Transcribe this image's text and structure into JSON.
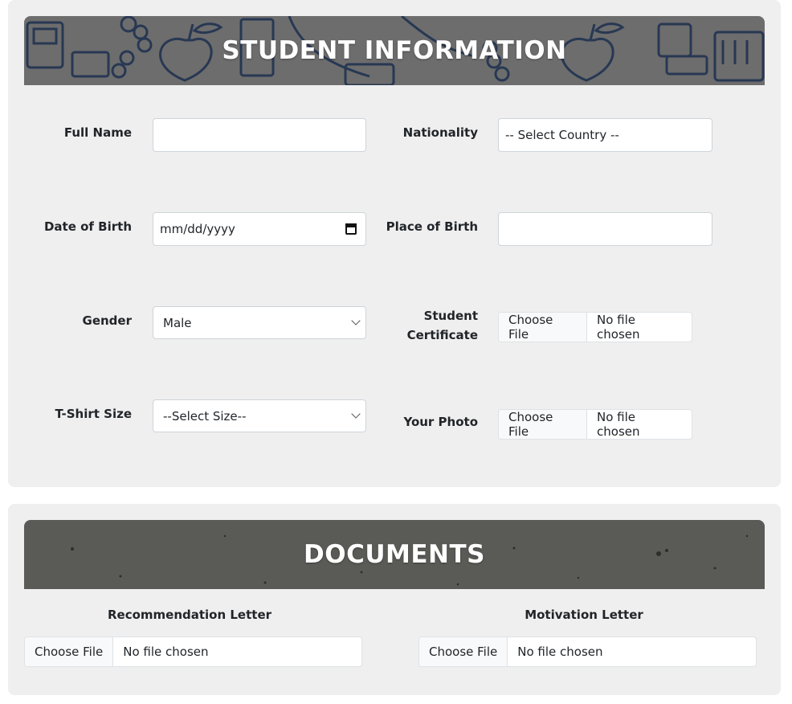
{
  "student": {
    "title": "STUDENT INFORMATION",
    "full_name_label": "Full Name",
    "full_name_value": "",
    "nationality_label": "Nationality",
    "nationality_value": "-- Select Country --",
    "dob_label": "Date of Birth",
    "dob_placeholder": "mm/dd/yyyy",
    "pob_label": "Place of Birth",
    "pob_value": "",
    "gender_label": "Gender",
    "gender_value": "Male",
    "certificate_label_line1": "Student",
    "certificate_label_line2": "Certificate",
    "tshirt_label": "T-Shirt Size",
    "tshirt_value": "--Select Size--",
    "photo_label": "Your Photo"
  },
  "file_input": {
    "button": "Choose File",
    "status": "No file chosen"
  },
  "documents": {
    "title": "DOCUMENTS",
    "recommendation_label": "Recommendation Letter",
    "motivation_label": "Motivation Letter"
  },
  "colors": {
    "card_bg": "#efefef",
    "banner_student": "#6d6d6d",
    "banner_docs": "#5a5b56",
    "pattern_stroke": "#1d2f4f"
  }
}
